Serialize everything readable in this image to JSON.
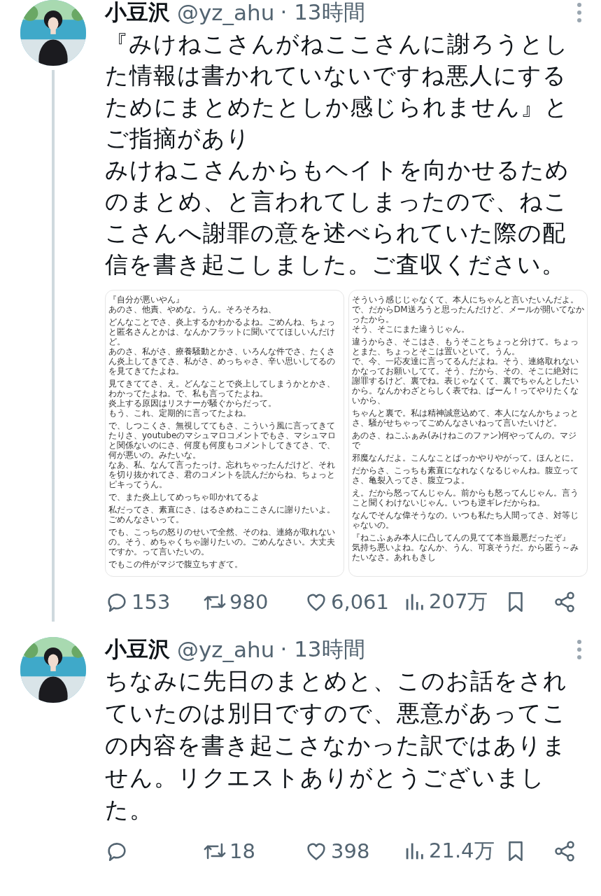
{
  "tweets": [
    {
      "name": "小豆沢",
      "handle": "@yz_ahu",
      "time": "· 13時間",
      "thread_line": true,
      "text": [
        "『みけねこさんがねここさんに謝ろうとした情報は書かれていないですね悪人にするためにまとめたとしか感じられません』とご指摘があり",
        "みけねこさんからもヘイトを向かせるためのまとめ、と言われてしまったので、ねここさんへ謝罪の意を述べられていた際の配信を書き起こしました。ご査収ください。"
      ],
      "documents": [
        {
          "paragraphs": [
            [
              "『自分が悪いやん』",
              "あのさ、他責、やめな。うん。そろそろね、"
            ],
            [
              "どんなことでさ、炎上するかわかるよね。ごめんね、ちょっと匿名さんとかは、なんかフラットに聞いててほしいんだけど。",
              "あのさ、私がさ、療養騒動とかさ、いろんな件でさ、たくさん炎上してきてさ、私がさ、めっちゃさ、辛い思いしてるのを見てきてたよね。"
            ],
            [
              "見てきててさ、え。どんなことで炎上してしまうかとかさ、わかってたよね。で、私も言ってたよね。",
              "炎上する原因はリスナーが騒ぐからだって。",
              "もう、これ、定期的に言ってたよね。"
            ],
            [
              "で、しつこくさ、無視しててもさ、こういう風に言ってきてたりさ、youtubeのマシュマロコメントでもさ、マシュマロと関係ないのにさ、何度も何度もコメントしてきてさ、で、何が悪いの。みたいな。",
              "なあ、私、なんて言ったっけ。忘れちゃったんだけど、それを切り抜かれてさ、君のコメントを読んだからね、ちょっとピキってうん。"
            ],
            [
              "で、また炎上してめっちゃ叩かれてるよ"
            ],
            [
              "私だってさ、素直にさ、はるさめねここさんに謝りたいよ。ごめんなさいって。"
            ],
            [
              "でも、こっちの怒りのせいで全然、そのね、連絡が取れないの。そう、めちゃくちゃ謝りたいの。ごめんなさい。大丈夫ですか。って言いたいの。"
            ],
            [
              "でもこの件がマジで腹立ちすぎて。"
            ]
          ]
        },
        {
          "paragraphs": [
            [
              "そういう感じじゃなくて、本人にちゃんと言いたいんだよ。で、だからDM送ろうと思ったんだけど、メールが開いてなかったから。",
              "そう、そこにまた違うじゃん。"
            ],
            [
              "違うからさ、そこはさ、もうそことちょっと分けて。ちょっとまた、ちょっとそこは置いといて。うん。",
              "で、今、一応友達に言ってるんだよね。そう、連絡取れないかなってお願いしてて。そう、だから、その、そこに絶対に謝罪するけど、裏でね。表じゃなくて、裏でちゃんとしたいから。なんかわざとらしく表でね、ばーん！ってやりたくないから、"
            ],
            [
              "ちゃんと裏で。私は精神誠意込めて、本人になんかちょっとさ、騒がせちゃってごめんなさいねって言いたいけど。"
            ],
            [
              "あのさ、ねこふぁみ(みけねこのファン)何やってんの。マジで"
            ],
            [
              "邪魔なんだよ。こんなことばっかやりやがって。ほんとに。"
            ],
            [
              "だからさ、こっちも素直になれなくなるじゃんね。腹立ってさ、亀裂入ってさ、腹立つよ。"
            ],
            [
              "え。だから怒ってんじゃん。前からも怒ってんじゃん。言うこと聞くわけないじゃん。いつも逆ギレだからね。"
            ],
            [
              "なんでそんな偉そうなの。いつも私たち人間ってさ、対等じゃないの。"
            ],
            [
              "『ねこふぁみ本人に凸してんの見てて本当最悪だったぞ』",
              "気持ち悪いよね。なんか、うん、可哀そうだ。から匿う～みたいなさ。あれもきし"
            ]
          ]
        }
      ],
      "actions": {
        "replies": "153",
        "retweets": "980",
        "likes": "6,061",
        "views": "207万"
      }
    },
    {
      "name": "小豆沢",
      "handle": "@yz_ahu",
      "time": "· 13時間",
      "text": [
        "ちなみに先日のまとめと、このお話をされていたのは別日ですので、悪意があってこの内容を書き起こさなかった訳ではありません。リクエストありがとうございました。"
      ],
      "actions": {
        "retweets": "18",
        "likes": "398",
        "views": "21.4万"
      }
    }
  ]
}
